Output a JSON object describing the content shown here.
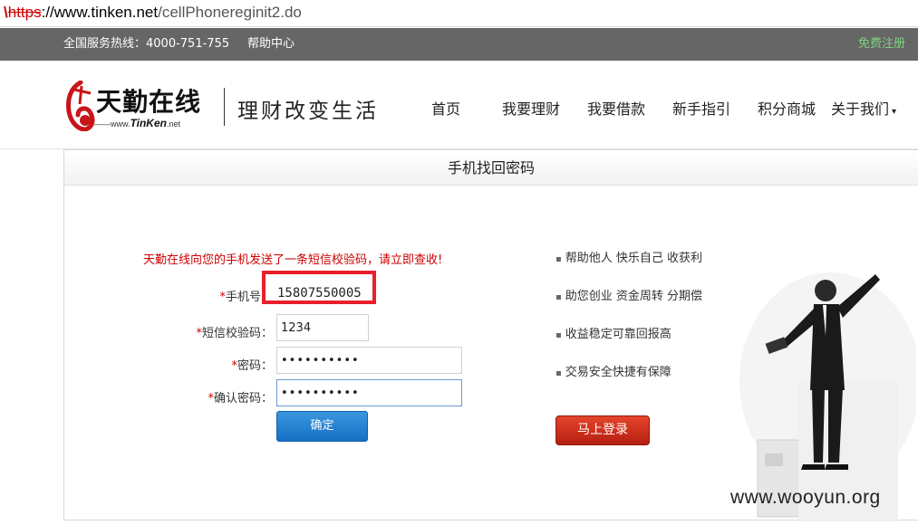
{
  "browser": {
    "lock_prefix": "\\",
    "scheme": "https",
    "separator": "://",
    "host": "www.tinken.net",
    "path": "/cellPhonereginit2.do"
  },
  "topbar": {
    "hotline": "全国服务热线：4000-751-755",
    "help": "帮助中心",
    "register": "免费注册"
  },
  "header": {
    "logo_cn": "天勤在线",
    "logo_en_prefix": "www.",
    "logo_en_brand": "TinKen",
    "logo_en_suffix": ".net",
    "slogan": "理财改变生活",
    "nav": [
      "首页",
      "我要理财",
      "我要借款",
      "新手指引",
      "积分商城",
      "关于我们"
    ],
    "about_caret": "▾"
  },
  "panel": {
    "title": "手机找回密码",
    "notice": "天勤在线向您的手机发送了一条短信校验码，请立即查收!",
    "required_mark": "*",
    "phone_label": "手机号：",
    "phone_value": "15807550005",
    "code_label": "短信校验码：",
    "code_value": "1234",
    "password_label": "密码：",
    "password_value": "••••••••••",
    "confirm_label": "确认密码：",
    "confirm_value": "••••••••••",
    "confirm_button": "确定",
    "benefits": [
      "帮助他人 快乐自己 收获利",
      "助您创业 资金周转 分期偿",
      "收益稳定可靠回报高",
      "交易安全快捷有保障"
    ],
    "login_button": "马上登录"
  },
  "watermark": "www.wooyun.org",
  "colors": {
    "topbar": "#666666",
    "accent_red": "#c00000",
    "highlight": "#ea1f2c",
    "button_blue": "#1570c5",
    "register_green": "#7fd27f"
  }
}
